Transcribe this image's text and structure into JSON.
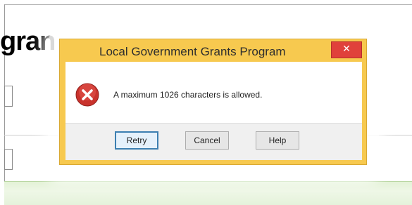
{
  "background": {
    "page_title": "gran"
  },
  "dialog": {
    "title": "Local Government Grants Program",
    "close_glyph": "✕",
    "icon": "error-icon",
    "message": "A maximum 1026 characters is allowed.",
    "buttons": {
      "retry": "Retry",
      "cancel": "Cancel",
      "help": "Help"
    },
    "colors": {
      "frame": "#f7c94f",
      "close": "#e0413b",
      "error_icon": "#c9322c"
    }
  }
}
